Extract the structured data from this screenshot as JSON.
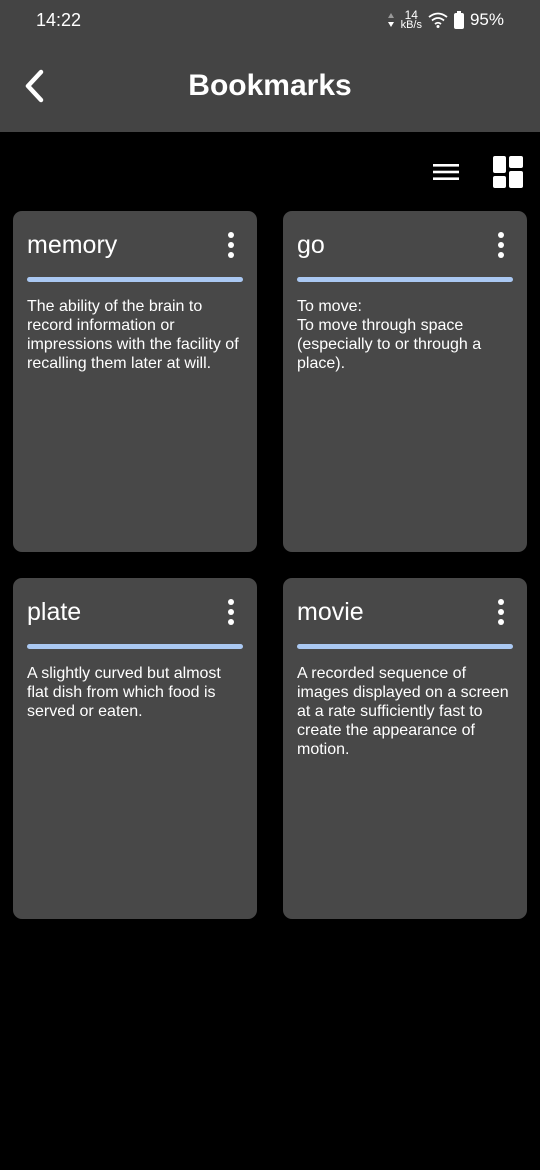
{
  "status_bar": {
    "time": "14:22",
    "net_speed_value": "14",
    "net_speed_unit": "kB/s",
    "battery": "95%"
  },
  "header": {
    "title": "Bookmarks",
    "back_icon": "back-arrow-icon"
  },
  "toolbar": {
    "list_view_icon": "list-view-icon",
    "grid_view_icon": "grid-view-icon",
    "active_view": "grid"
  },
  "cards": [
    {
      "word": "memory",
      "definition": "The ability of the brain to record information or impressions with the facility of recalling them later at will."
    },
    {
      "word": "go",
      "definition": "To move:\n To move through space (especially to or through a place)."
    },
    {
      "word": "plate",
      "definition": "A slightly curved but almost flat dish from which food is served or eaten."
    },
    {
      "word": "movie",
      "definition": "A recorded sequence of images displayed on a screen at a rate sufficiently fast to create the appearance of motion."
    }
  ],
  "colors": {
    "bar_background": "#444444",
    "card_background": "#484848",
    "divider": "#aac8f2",
    "page_background": "#000000"
  }
}
